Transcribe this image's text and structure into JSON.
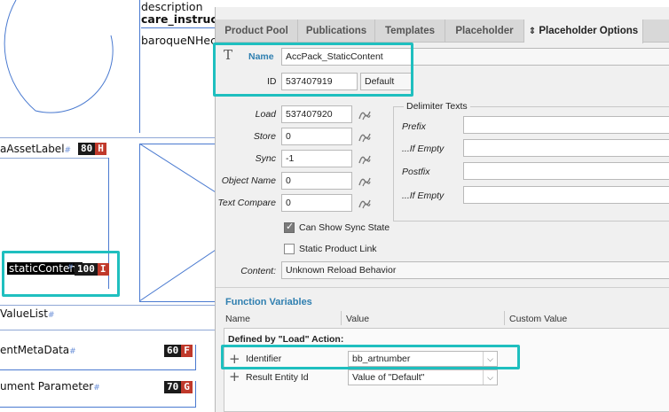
{
  "canvas": {
    "description_label": "description",
    "care_label": "care_instructio",
    "baroque_label": "baroqueNHec",
    "asset_label": "aAssetLabel",
    "asset_badge": {
      "num": "80",
      "letter": "H",
      "color": "#c0392b"
    },
    "static_label": "staticContent",
    "static_badge": {
      "num": "100",
      "letter": "I",
      "color": "#c0392b"
    },
    "valuelist_label": "ValueList",
    "meta_label": "entMetaData",
    "meta_badge": {
      "num": "60",
      "letter": "F",
      "color": "#c0392b"
    },
    "param_label": "ument Parameter",
    "param_badge": {
      "num": "70",
      "letter": "G",
      "color": "#c0392b"
    }
  },
  "tabs": [
    "Product Pool",
    "Publications",
    "Templates",
    "Placeholder",
    "Placeholder Options"
  ],
  "active_tab_icon": "⇕",
  "name_row": {
    "label": "Name",
    "value": "AccPack_StaticContent"
  },
  "id_row": {
    "label": "ID",
    "value": "537407919",
    "default": "Default"
  },
  "actions": [
    {
      "label": "Load",
      "value": "537407920"
    },
    {
      "label": "Store",
      "value": "0"
    },
    {
      "label": "Sync",
      "value": "-1"
    },
    {
      "label": "Object Name",
      "value": "0"
    },
    {
      "label": "Text Compare",
      "value": "0"
    }
  ],
  "delimiter": {
    "title": "Delimiter Texts",
    "rows": [
      "Prefix",
      "...If Empty",
      "Postfix",
      "...If Empty"
    ]
  },
  "checks": {
    "can_show_sync": {
      "label": "Can Show Sync State",
      "checked": true
    },
    "static_link": {
      "label": "Static Product Link",
      "checked": false
    }
  },
  "content": {
    "label": "Content:",
    "value": "Unknown Reload Behavior"
  },
  "function_vars": {
    "title": "Function Variables",
    "columns": [
      "Name",
      "Value",
      "Custom Value"
    ],
    "group": "Defined by \"Load\" Action:",
    "rows": [
      {
        "name": "Identifier",
        "value": "bb_artnumber"
      },
      {
        "name": "Result Entity Id",
        "value": "Value of \"Default\""
      }
    ]
  },
  "colors": {
    "highlight": "#1fbfbf",
    "accent": "#2f7fb0",
    "frame": "#4a7ad0"
  }
}
